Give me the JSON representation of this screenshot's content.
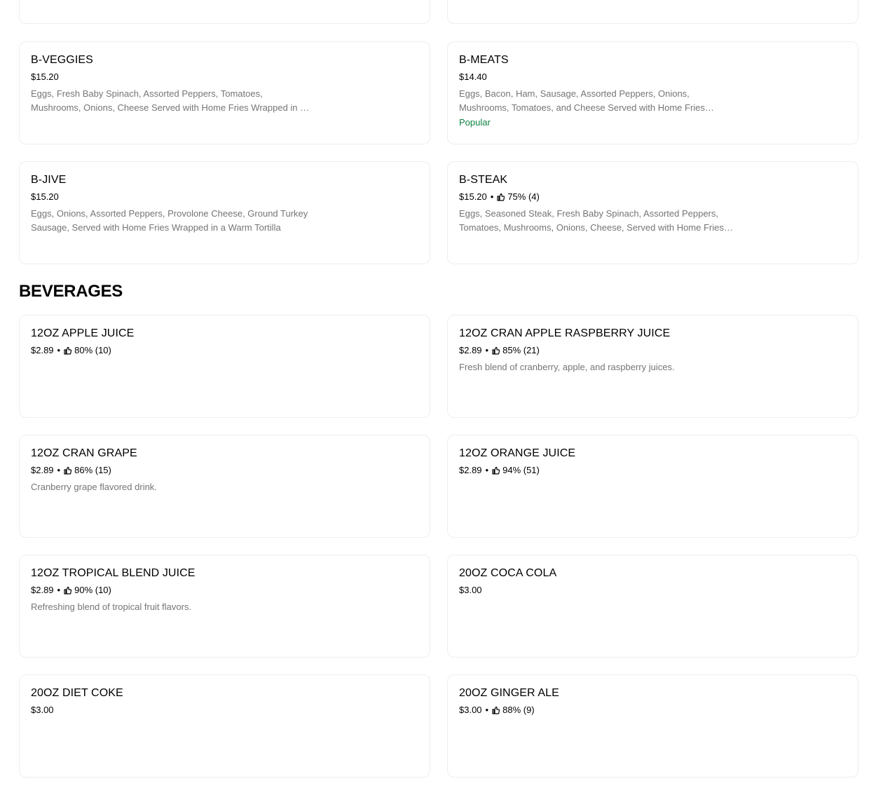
{
  "breakfast_items": [
    {
      "name": "B-VEGGIES",
      "price": "$15.20",
      "description": "Eggs, Fresh Baby Spinach, Assorted Peppers, Tomatoes, Mushrooms, Onions, Cheese Served with Home Fries Wrapped in a Warm Tortilla"
    },
    {
      "name": "B-MEATS",
      "price": "$14.40",
      "description": "Eggs, Bacon, Ham, Sausage, Assorted Peppers, Onions, Mushrooms, Tomatoes, and Cheese Served with Home Fries Wrapped in a Warm Tortilla",
      "badge": "Popular"
    },
    {
      "name": "B-JIVE",
      "price": "$15.20",
      "description": "Eggs, Onions, Assorted Peppers, Provolone Cheese, Ground Turkey Sausage, Served with Home Fries Wrapped in a Warm Tortilla"
    },
    {
      "name": "B-STEAK",
      "price": "$15.20",
      "rating": "75% (4)",
      "description": "Eggs, Seasoned Steak, Fresh Baby Spinach, Assorted Peppers, Tomatoes, Mushrooms, Onions, Cheese, Served with Home Fries Wrapped in a Warm Tortilla"
    }
  ],
  "beverages": {
    "title": "BEVERAGES",
    "items": [
      {
        "name": "12OZ APPLE JUICE",
        "price": "$2.89",
        "rating": "80% (10)"
      },
      {
        "name": "12OZ CRAN APPLE RASPBERRY JUICE",
        "price": "$2.89",
        "rating": "85% (21)",
        "description": "Fresh blend of cranberry, apple, and raspberry juices."
      },
      {
        "name": "12OZ CRAN GRAPE",
        "price": "$2.89",
        "rating": "86% (15)",
        "description": "Cranberry grape flavored drink."
      },
      {
        "name": "12OZ ORANGE JUICE",
        "price": "$2.89",
        "rating": "94% (51)"
      },
      {
        "name": "12OZ TROPICAL BLEND JUICE",
        "price": "$2.89",
        "rating": "90% (10)",
        "description": "Refreshing blend of tropical fruit flavors."
      },
      {
        "name": "20OZ COCA COLA",
        "price": "$3.00"
      },
      {
        "name": "20OZ DIET COKE",
        "price": "$3.00"
      },
      {
        "name": "20OZ GINGER ALE",
        "price": "$3.00",
        "rating": "88% (9)"
      }
    ]
  },
  "icons": {
    "rating": "thumbs-up-icon"
  },
  "colors": {
    "popular_badge": "#0e8345",
    "description_text": "#757575",
    "card_border": "#eeeeee"
  }
}
